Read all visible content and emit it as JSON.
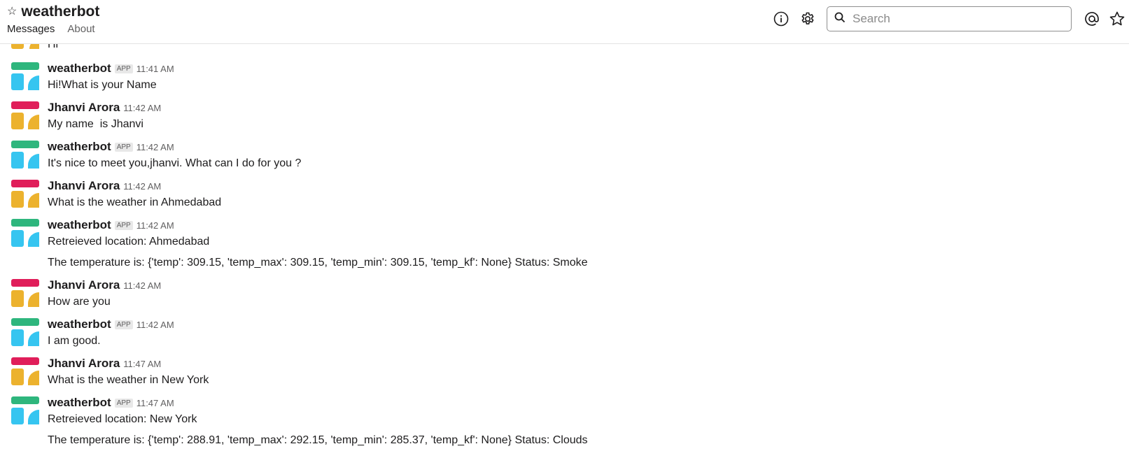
{
  "header": {
    "channel_name": "weatherbot",
    "tabs": [
      "Messages",
      "About"
    ],
    "search_placeholder": "Search",
    "icons": [
      "star-icon",
      "info-icon",
      "gear-icon",
      "search-icon",
      "mention-icon",
      "starred-icon"
    ]
  },
  "partial_message": {
    "text": "Hi"
  },
  "messages": [
    {
      "author": "weatherbot",
      "app_badge": "APP",
      "time": "11:41 AM",
      "text": "Hi!What is your Name"
    },
    {
      "author": "Jhanvi Arora",
      "time": "11:42 AM",
      "text": "My name  is Jhanvi"
    },
    {
      "author": "weatherbot",
      "app_badge": "APP",
      "time": "11:42 AM",
      "text": "It's nice to meet you,jhanvi. What can I do for you ?"
    },
    {
      "author": "Jhanvi Arora",
      "time": "11:42 AM",
      "text": "What is the weather in Ahmedabad"
    },
    {
      "author": "weatherbot",
      "app_badge": "APP",
      "time": "11:42 AM",
      "text": "Retreieved location: Ahmedabad",
      "extra": "The temperature is: {'temp': 309.15, 'temp_max': 309.15, 'temp_min': 309.15, 'temp_kf': None} Status: Smoke"
    },
    {
      "author": "Jhanvi Arora",
      "time": "11:42 AM",
      "text": "How are you"
    },
    {
      "author": "weatherbot",
      "app_badge": "APP",
      "time": "11:42 AM",
      "text": "I am good."
    },
    {
      "author": "Jhanvi Arora",
      "time": "11:47 AM",
      "text": "What is the weather in New York"
    },
    {
      "author": "weatherbot",
      "app_badge": "APP",
      "time": "11:47 AM",
      "text": "Retreieved location: New York",
      "extra": "The temperature is: {'temp': 288.91, 'temp_max': 292.15, 'temp_min': 285.37, 'temp_kf': None} Status: Clouds"
    }
  ],
  "colors": {
    "bot_avatar_top": "#2eb67d",
    "bot_avatar_bottom": "#36c5f0",
    "user_avatar_top": "#e01e5a",
    "user_avatar_bottom": "#ecb22e"
  }
}
